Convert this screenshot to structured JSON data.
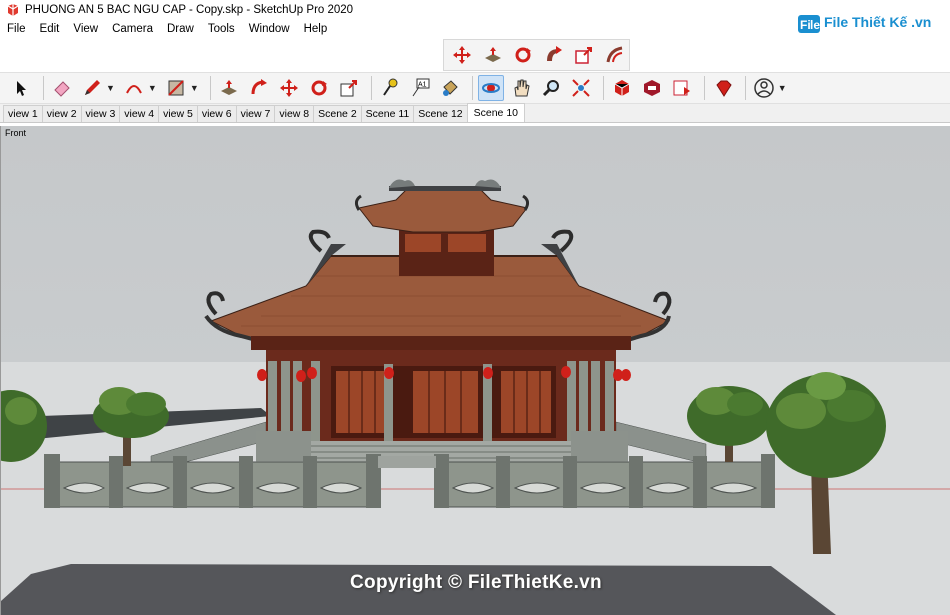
{
  "window": {
    "title": "PHUONG AN 5 BAC NGU CAP - Copy.skp - SketchUp Pro 2020",
    "brand_mark": "File Thiết Kế .vn"
  },
  "menu": [
    "File",
    "Edit",
    "View",
    "Camera",
    "Draw",
    "Tools",
    "Window",
    "Help"
  ],
  "toolbar_top": {
    "icons": [
      "move-icon",
      "push-pull-icon",
      "rotate-icon",
      "follow-me-icon",
      "scale-icon",
      "offset-icon"
    ]
  },
  "toolbar_main": {
    "icons": [
      "select-icon",
      "eraser-icon",
      "pencil-icon",
      "arc-icon",
      "rectangle-icon",
      "push-pull-icon",
      "follow-me-icon",
      "move-icon",
      "rotate-icon",
      "scale-icon",
      "tape-measure-icon",
      "text-icon",
      "paint-bucket-icon",
      "orbit-icon",
      "pan-icon",
      "zoom-icon",
      "zoom-extents-icon",
      "3d-warehouse-icon",
      "extension-warehouse-icon",
      "layout-icon",
      "ruby-icon",
      "account-icon"
    ],
    "active": "orbit-icon"
  },
  "scene_tabs": [
    "view 1",
    "view 2",
    "view 3",
    "view 4",
    "view 5",
    "view 6",
    "view 7",
    "view 8",
    "Scene 2",
    "Scene 11",
    "Scene 12",
    "Scene 10"
  ],
  "active_tab": "Scene 10",
  "viewport": {
    "view_name": "Front",
    "watermark": "Copyright © FileThietKe.vn"
  },
  "colors": {
    "roof": "#9a5a3c",
    "wood": "#6b2a1c",
    "stone": "#8e958c",
    "ground": "#d9dbdc",
    "accent_red": "#d0201a",
    "brand_blue": "#1a8fd0"
  }
}
